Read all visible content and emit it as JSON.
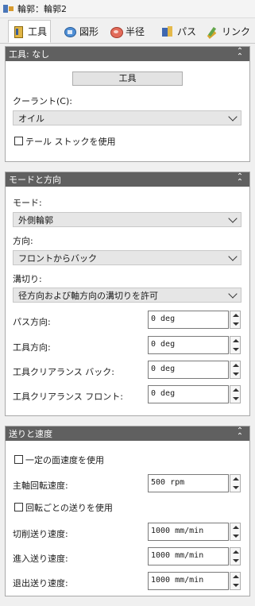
{
  "window": {
    "title": "輪郭：輪郭2"
  },
  "tabs": [
    {
      "label": "工具"
    },
    {
      "label": "図形"
    },
    {
      "label": "半径"
    },
    {
      "label": "パス"
    },
    {
      "label": "リンク"
    }
  ],
  "tool_panel": {
    "header": "工具: なし",
    "tool_button": "工具",
    "coolant_label": "クーラント(C):",
    "coolant_value": "オイル",
    "tailstock_label": "テール ストックを使用"
  },
  "mode_panel": {
    "header": "モードと方向",
    "mode_label": "モード:",
    "mode_value": "外側輪郭",
    "direction_label": "方向:",
    "direction_value": "フロントからバック",
    "grooving_label": "溝切り:",
    "grooving_value": "径方向および軸方向の溝切りを許可",
    "path_direction_label": "パス方向:",
    "path_direction_value": "0 deg",
    "tool_direction_label": "工具方向:",
    "tool_direction_value": "0 deg",
    "clearance_back_label": "工具クリアランス バック:",
    "clearance_back_value": "0 deg",
    "clearance_front_label": "工具クリアランス フロント:",
    "clearance_front_value": "0 deg"
  },
  "feed_panel": {
    "header": "送りと速度",
    "constant_surface_label": "一定の面速度を使用",
    "spindle_speed_label": "主軸回転速度:",
    "spindle_speed_value": "500 rpm",
    "feed_per_rev_label": "回転ごとの送りを使用",
    "cutting_feed_label": "切削送り速度:",
    "cutting_feed_value": "1000 mm/min",
    "lead_in_feed_label": "進入送り速度:",
    "lead_in_feed_value": "1000 mm/min",
    "lead_out_feed_label": "退出送り速度:",
    "lead_out_feed_value": "1000 mm/min"
  }
}
